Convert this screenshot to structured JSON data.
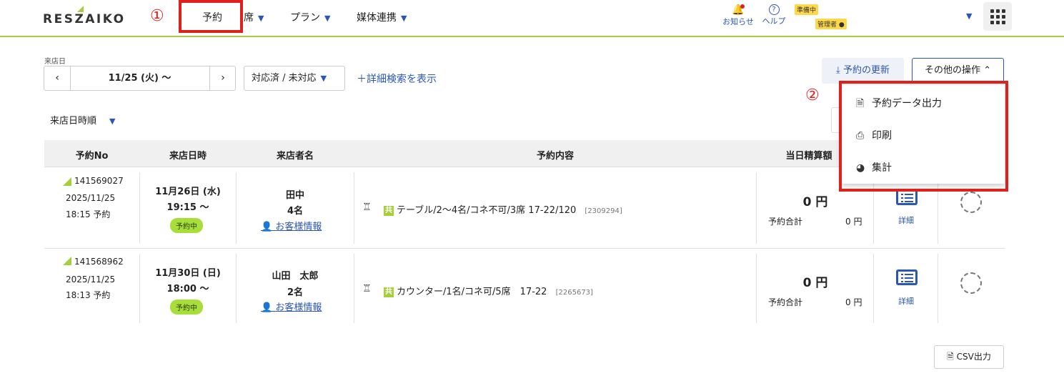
{
  "header": {
    "logo": "RESZAIKO",
    "nav": [
      {
        "label": "予約"
      },
      {
        "label": "席"
      },
      {
        "label": "プラン"
      },
      {
        "label": "媒体連携"
      }
    ],
    "notifications_label": "お知らせ",
    "help_label": "ヘルプ",
    "status_badge": "準備中",
    "user_badge": "管理者",
    "annotation_1": "①",
    "annotation_2": "②"
  },
  "filters": {
    "date_label": "来店日",
    "date_value": "11/25 (火) 〜",
    "status_select": "対応済 / 未対応",
    "advanced_search": "詳細検索を表示",
    "sort": "来店日時順",
    "update_button": "予約の更新",
    "other_ops_button": "その他の操作"
  },
  "dropdown": {
    "items": [
      {
        "label": "予約データ出力",
        "icon": "file-download-icon"
      },
      {
        "label": "印刷",
        "icon": "printer-icon"
      },
      {
        "label": "集計",
        "icon": "pie-chart-icon"
      }
    ]
  },
  "table": {
    "headers": [
      "予約No",
      "来店日時",
      "来店者名",
      "予約内容",
      "当日精算額"
    ],
    "rows": [
      {
        "no": "141569027",
        "date": "2025/11/25",
        "time_reserved": "18:15 予約",
        "visit_date": "11月26日 (水)",
        "visit_time": "19:15 〜",
        "status": "予約中",
        "name": "田中",
        "count": "4名",
        "customer_link": "お客様情報",
        "shared_label": "共",
        "content": "テーブル/2〜4名/コネ不可/3席 17-22/120",
        "content_id": "[2309294]",
        "amount": "0 円",
        "total_label": "予約合計",
        "total_value": "0 円",
        "detail_label": "詳細"
      },
      {
        "no": "141568962",
        "date": "2025/11/25",
        "time_reserved": "18:13 予約",
        "visit_date": "11月30日 (日)",
        "visit_time": "18:00 〜",
        "status": "予約中",
        "name": "山田　太郎",
        "count": "2名",
        "customer_link": "お客様情報",
        "shared_label": "共",
        "content": "カウンター/1名/コネ可/5席　17-22",
        "content_id": "[2265673]",
        "amount": "0 円",
        "total_label": "予約合計",
        "total_value": "0 円",
        "detail_label": "詳細"
      }
    ]
  },
  "footer": {
    "csv_button": "CSV出力"
  },
  "colors": {
    "brand_green": "#a7cf3b",
    "accent_blue": "#2a56b8",
    "annotation_red": "#e0211b"
  }
}
